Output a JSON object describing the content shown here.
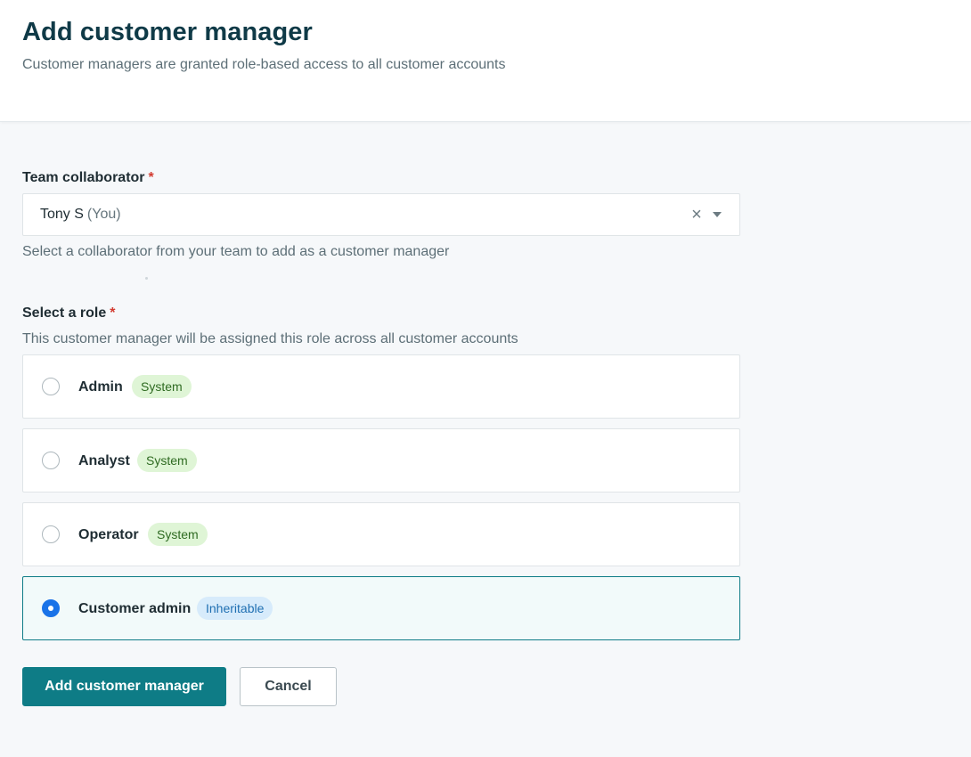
{
  "header": {
    "title": "Add customer manager",
    "subtitle": "Customer managers are granted role-based access to all customer accounts"
  },
  "collaborator": {
    "label": "Team collaborator",
    "required_mark": "*",
    "value": "Tony S",
    "value_suffix": "(You)",
    "clear_glyph": "×",
    "helper": "Select a collaborator from your team to add as a customer manager"
  },
  "role": {
    "label": "Select a role",
    "required_mark": "*",
    "helper": "This customer manager will be assigned this role across all customer accounts",
    "options": [
      {
        "name": "Admin",
        "badge": "System",
        "selected": false
      },
      {
        "name": "Analyst",
        "badge": "System",
        "selected": false
      },
      {
        "name": "Operator",
        "badge": "System",
        "selected": false
      },
      {
        "name": "Customer admin",
        "badge": "Inheritable",
        "selected": true
      }
    ]
  },
  "actions": {
    "submit_label": "Add customer manager",
    "cancel_label": "Cancel"
  },
  "colors": {
    "primary": "#0e7c86",
    "title": "#0f3a47",
    "radio_checked": "#1a73e8",
    "system_badge_bg": "#dff5d6",
    "inherit_badge_bg": "#d7ebfb",
    "required": "#d23a2f"
  }
}
